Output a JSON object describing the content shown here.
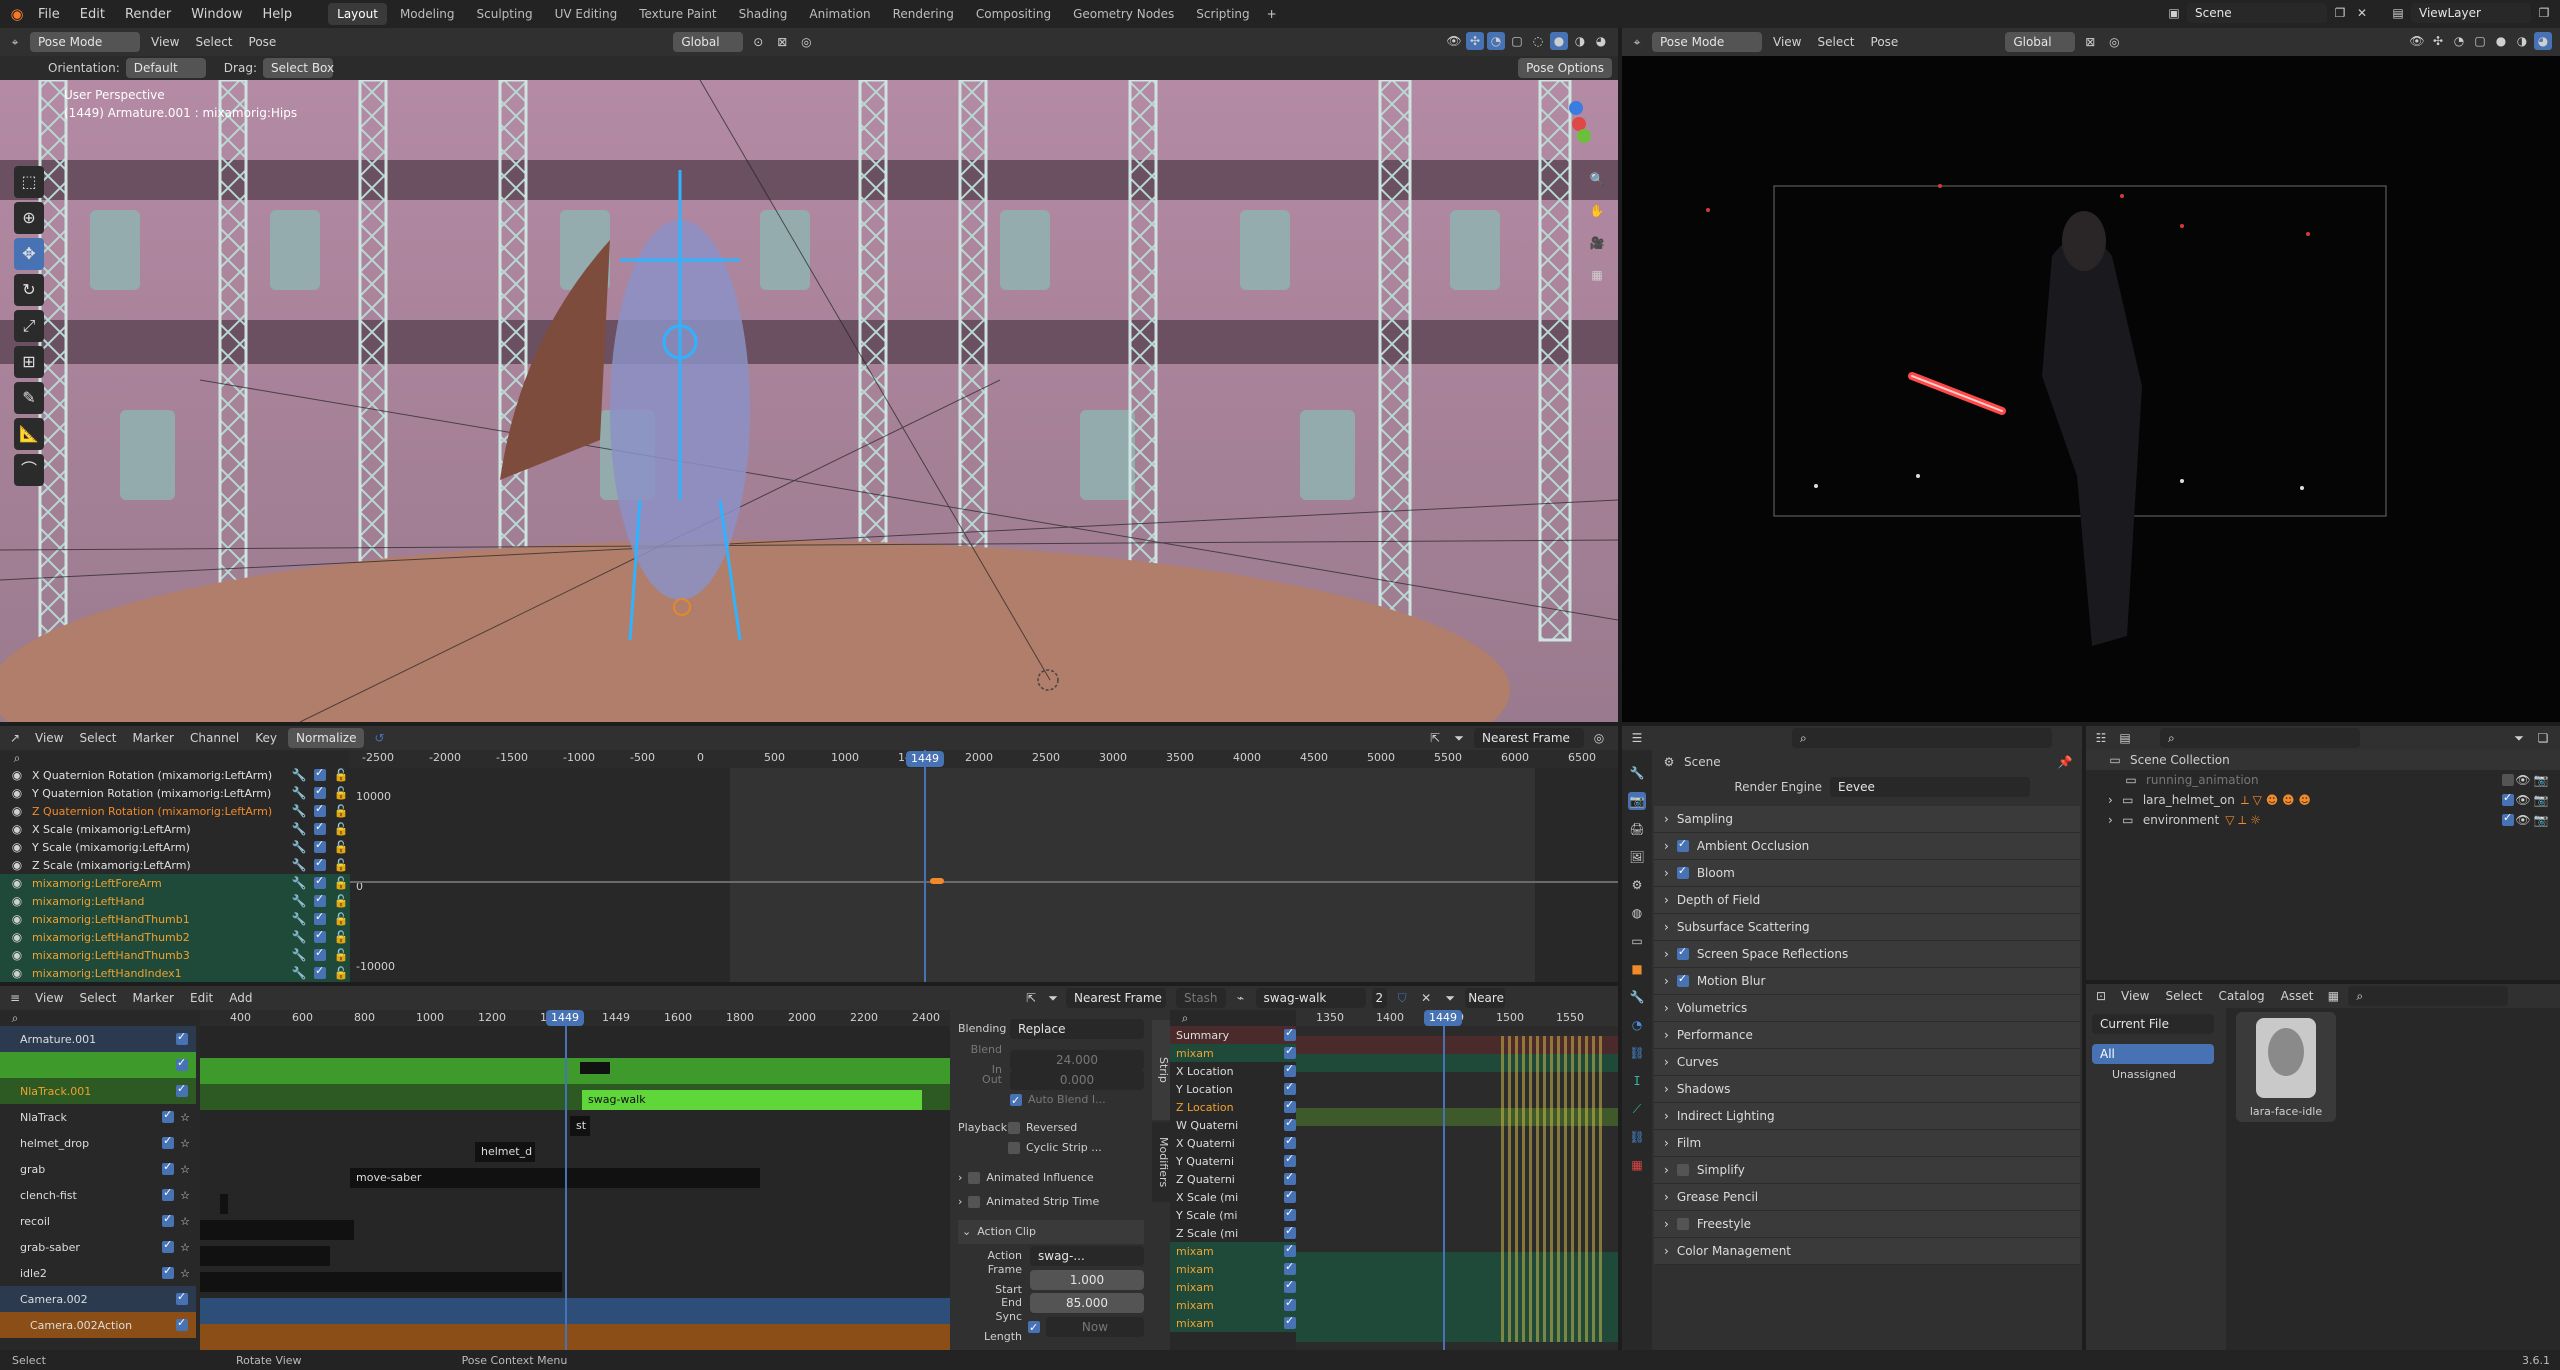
{
  "app": {
    "version": "3.6.1"
  },
  "topbar": {
    "menus": [
      "File",
      "Edit",
      "Render",
      "Window",
      "Help"
    ],
    "workspaces": [
      "Layout",
      "Modeling",
      "Sculpting",
      "UV Editing",
      "Texture Paint",
      "Shading",
      "Animation",
      "Rendering",
      "Compositing",
      "Geometry Nodes",
      "Scripting"
    ],
    "active_workspace": "Layout",
    "scene": "Scene",
    "view_layer": "ViewLayer"
  },
  "viewport_left": {
    "mode": "Pose Mode",
    "menus": [
      "View",
      "Select",
      "Pose"
    ],
    "orientation_label": "Global",
    "tool_header": {
      "orientation_label": "Orientation:",
      "orientation_value": "Default",
      "drag_label": "Drag:",
      "drag_value": "Select Box",
      "pose_options": "Pose Options"
    },
    "overlay_text": {
      "line1": "User Perspective",
      "line2": "(1449) Armature.001 : mixamorig:Hips"
    }
  },
  "viewport_right": {
    "mode": "Pose Mode",
    "menus": [
      "View",
      "Select",
      "Pose"
    ],
    "orientation_label": "Global"
  },
  "graph_editor": {
    "menus": [
      "View",
      "Select",
      "Marker",
      "Channel",
      "Key"
    ],
    "normalize": "Normalize",
    "snap": "Nearest Frame",
    "ruler": [
      "-2500",
      "-2000",
      "-1500",
      "-1000",
      "-500",
      "0",
      "500",
      "1000",
      "1449",
      "2000",
      "2500",
      "3000",
      "3500",
      "4000",
      "4500",
      "5000",
      "5500",
      "6000",
      "6500"
    ],
    "current_frame": "1449",
    "y_labels": [
      "10000",
      "0",
      "-10000"
    ],
    "channels": [
      {
        "name": "X Quaternion Rotation (mixamorig:LeftArm)",
        "color": "#e0e0e0"
      },
      {
        "name": "Y Quaternion Rotation (mixamorig:LeftArm)",
        "color": "#e0e0e0"
      },
      {
        "name": "Z Quaternion Rotation (mixamorig:LeftArm)",
        "color": "#f08a2a"
      },
      {
        "name": "X Scale (mixamorig:LeftArm)",
        "color": "#e0e0e0"
      },
      {
        "name": "Y Scale (mixamorig:LeftArm)",
        "color": "#e0e0e0"
      },
      {
        "name": "Z Scale (mixamorig:LeftArm)",
        "color": "#e0e0e0"
      },
      {
        "name": "mixamorig:LeftForeArm",
        "color": "#f0a030"
      },
      {
        "name": "mixamorig:LeftHand",
        "color": "#f0a030"
      },
      {
        "name": "mixamorig:LeftHandThumb1",
        "color": "#f0a030"
      },
      {
        "name": "mixamorig:LeftHandThumb2",
        "color": "#f0a030"
      },
      {
        "name": "mixamorig:LeftHandThumb3",
        "color": "#f0a030"
      },
      {
        "name": "mixamorig:LeftHandIndex1",
        "color": "#f0a030"
      }
    ]
  },
  "nla_editor": {
    "menus": [
      "View",
      "Select",
      "Marker",
      "Edit",
      "Add"
    ],
    "snap": "Nearest Frame",
    "ruler": [
      "400",
      "600",
      "800",
      "1000",
      "1200",
      "14",
      "1449",
      "1600",
      "1800",
      "2000",
      "2200",
      "2400",
      "2600"
    ],
    "current_frame": "1449",
    "tracks": [
      {
        "name": "Armature.001",
        "kind": "object"
      },
      {
        "name": "",
        "kind": "action"
      },
      {
        "name": "NlaTrack.001",
        "kind": "orange"
      },
      {
        "name": "NlaTrack",
        "kind": "track"
      },
      {
        "name": "helmet_drop",
        "kind": "track"
      },
      {
        "name": "grab",
        "kind": "track"
      },
      {
        "name": "clench-fist",
        "kind": "track"
      },
      {
        "name": "recoil",
        "kind": "track"
      },
      {
        "name": "grab-saber",
        "kind": "track"
      },
      {
        "name": "idle2",
        "kind": "track"
      },
      {
        "name": "Camera.002",
        "kind": "object"
      },
      {
        "name": "Camera.002Action",
        "kind": "action-orange"
      }
    ],
    "strips": {
      "swag_walk": "swag-walk",
      "st": "st",
      "helmet_d": "helmet_d",
      "move_saber": "move-saber"
    },
    "sidebar": {
      "tabs": [
        "Strip",
        "Modifiers"
      ],
      "blending_label": "Blending",
      "blending_value": "Replace",
      "blend_in_label": "Blend In",
      "blend_in_value": "24.000",
      "out_label": "Out",
      "out_value": "0.000",
      "auto_blend": "Auto Blend I...",
      "playback_label": "Playback",
      "reversed": "Reversed",
      "cyclic": "Cyclic Strip ...",
      "animated_influence": "Animated Influence",
      "animated_strip_time": "Animated Strip Time",
      "action_clip": "Action Clip",
      "action_label": "Action",
      "action_value": "swag-...",
      "frame_start_label": "Frame Start",
      "frame_start_value": "1.000",
      "end_label": "End",
      "end_value": "85.000",
      "sync_length_label": "Sync Length",
      "now": "Now"
    }
  },
  "dopesheet": {
    "stash": "Stash",
    "action": "swag-walk",
    "users": "2",
    "snap": "Neare",
    "ruler": [
      "1350",
      "1400",
      "1449",
      "1500",
      "1550"
    ],
    "current_frame": "1449",
    "channels": [
      "Summary",
      "mixam",
      "X Location",
      "Y Location",
      "Z Location",
      "W Quaterni",
      "X Quaterni",
      "Y Quaterni",
      "Z Quaterni",
      "X Scale (mi",
      "Y Scale (mi",
      "Z Scale (mi",
      "mixam",
      "mixam",
      "mixam",
      "mixam",
      "mixam"
    ]
  },
  "properties": {
    "scene": "Scene",
    "render_engine_label": "Render Engine",
    "render_engine_value": "Eevee",
    "sections": [
      {
        "label": "Sampling",
        "check": null
      },
      {
        "label": "Ambient Occlusion",
        "check": true
      },
      {
        "label": "Bloom",
        "check": true
      },
      {
        "label": "Depth of Field",
        "check": null
      },
      {
        "label": "Subsurface Scattering",
        "check": null
      },
      {
        "label": "Screen Space Reflections",
        "check": true
      },
      {
        "label": "Motion Blur",
        "check": true
      },
      {
        "label": "Volumetrics",
        "check": null
      },
      {
        "label": "Performance",
        "check": null
      },
      {
        "label": "Curves",
        "check": null
      },
      {
        "label": "Shadows",
        "check": null
      },
      {
        "label": "Indirect Lighting",
        "check": null
      },
      {
        "label": "Film",
        "check": null
      },
      {
        "label": "Simplify",
        "check": false
      },
      {
        "label": "Grease Pencil",
        "check": null
      },
      {
        "label": "Freestyle",
        "check": false
      },
      {
        "label": "Color Management",
        "check": null
      }
    ]
  },
  "outliner": {
    "root": "Scene Collection",
    "items": [
      "running_animation",
      "lara_helmet_on",
      "environment"
    ]
  },
  "asset_browser": {
    "menus": [
      "View",
      "Select",
      "Catalog",
      "Asset"
    ],
    "library": "Current File",
    "catalogs": [
      "All",
      "Unassigned"
    ],
    "asset": "lara-face-idle"
  },
  "statusbar": {
    "items": [
      "Select",
      "Rotate View",
      "Pose Context Menu"
    ],
    "version": "3.6.1"
  }
}
